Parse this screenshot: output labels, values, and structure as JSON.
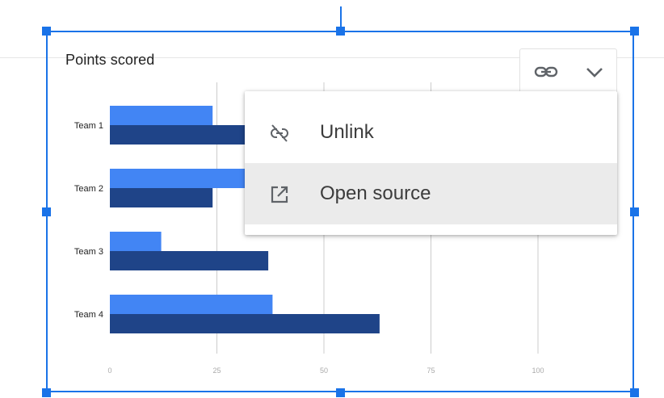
{
  "chart_data": {
    "type": "bar",
    "orientation": "horizontal",
    "title": "Points scored",
    "categories": [
      "Team 1",
      "Team 2",
      "Team 3",
      "Team 4"
    ],
    "series": [
      {
        "values": [
          24,
          32,
          12,
          38
        ],
        "color": "#4285f4"
      },
      {
        "values": [
          32,
          24,
          37,
          63
        ],
        "color": "#1f4488"
      }
    ],
    "x_ticks": [
      "0",
      "25",
      "50",
      "75",
      "100"
    ],
    "xlim": [
      0,
      125
    ],
    "grid": true
  },
  "toolbar": {
    "link_icon": "link-icon",
    "dropdown_icon": "chevron-down-icon"
  },
  "menu": {
    "items": [
      {
        "label": "Unlink",
        "icon": "unlink-icon"
      },
      {
        "label": "Open source",
        "icon": "open-in-new-icon"
      }
    ]
  },
  "colors": {
    "accent": "#1a73e8",
    "menu_highlight": "#ebebeb"
  }
}
